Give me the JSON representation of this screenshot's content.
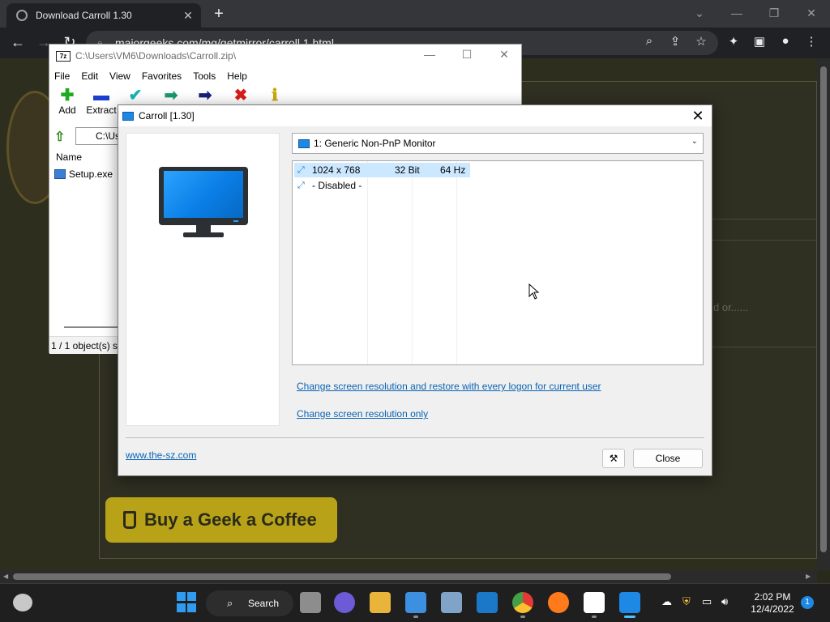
{
  "browser": {
    "tab_title": "Download Carroll 1.30",
    "tab_close": "✕",
    "new_tab": "+",
    "url": "majorgeeks.com/mg/getmirror/carroll,1.html",
    "minimize": "⌄",
    "restore": "—",
    "maximize": "❐",
    "close": "✕"
  },
  "page": {
    "coffee_label": "Buy a Geek a Coffee",
    "fragment_text": "d or......"
  },
  "zip": {
    "title": "C:\\Users\\VM6\\Downloads\\Carroll.zip\\",
    "logo": "7z",
    "menu": [
      "File",
      "Edit",
      "View",
      "Favorites",
      "Tools",
      "Help"
    ],
    "tools": [
      {
        "label": "Add",
        "glyph": "✚",
        "color": "#1faa1f"
      },
      {
        "label": "Extract",
        "glyph": "▬",
        "color": "#1a3fd0"
      },
      {
        "label": "",
        "glyph": "✔",
        "color": "#17b3b3"
      },
      {
        "label": "",
        "glyph": "➡",
        "color": "#1a9a6a"
      },
      {
        "label": "",
        "glyph": "➡",
        "color": "#16207a"
      },
      {
        "label": "",
        "glyph": "✖",
        "color": "#d81c1c"
      },
      {
        "label": "",
        "glyph": "ℹ",
        "color": "#c8a90a"
      }
    ],
    "path": "C:\\Us",
    "column_name": "Name",
    "file": "Setup.exe",
    "status": "1 / 1 object(s) se"
  },
  "carroll": {
    "title": "Carroll [1.30]",
    "monitor_select": "1: Generic Non-PnP Monitor",
    "modes": [
      {
        "res": "1024 x 768",
        "bits": "32 Bit",
        "hz": "64 Hz",
        "selected": true
      },
      {
        "res": "- Disabled -",
        "bits": "",
        "hz": "",
        "selected": false
      }
    ],
    "link_restore": "Change screen resolution and restore with every logon for current user",
    "link_only": "Change screen resolution only",
    "site": "www.the-sz.com",
    "close_button": "Close",
    "settings_glyph": "⚒"
  },
  "taskbar": {
    "search_label": "Search",
    "time": "2:02 PM",
    "date": "12/4/2022",
    "notifications": "1"
  },
  "colors": {
    "accent": "#1e88e5",
    "link": "#0a64b4",
    "selection": "#cce8ff"
  }
}
